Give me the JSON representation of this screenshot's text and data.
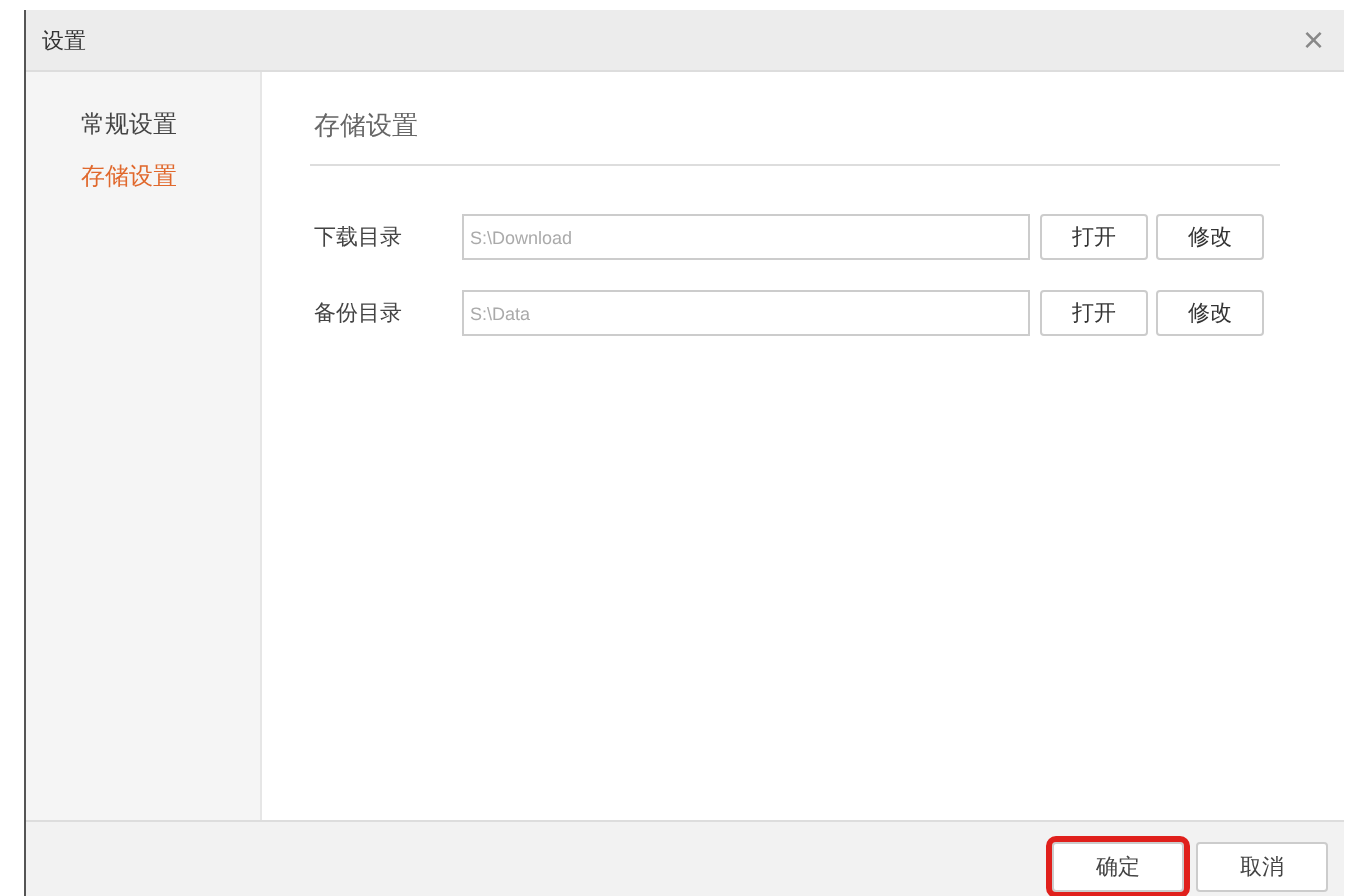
{
  "window": {
    "title": "设置",
    "close": "×"
  },
  "sidebar": {
    "items": [
      {
        "label": "常规设置",
        "selected": false
      },
      {
        "label": "存储设置",
        "selected": true
      }
    ]
  },
  "section": {
    "title": "存储设置"
  },
  "rows": [
    {
      "label": "下载目录",
      "value": "S:\\Download",
      "buttons": [
        "打开",
        "修改"
      ]
    },
    {
      "label": "备份目录",
      "value": "S:\\Data",
      "buttons": [
        "打开",
        "修改"
      ]
    }
  ],
  "footer": {
    "buttons": [
      {
        "label": "确定",
        "highlighted": true
      },
      {
        "label": "取消",
        "highlighted": false
      }
    ]
  }
}
